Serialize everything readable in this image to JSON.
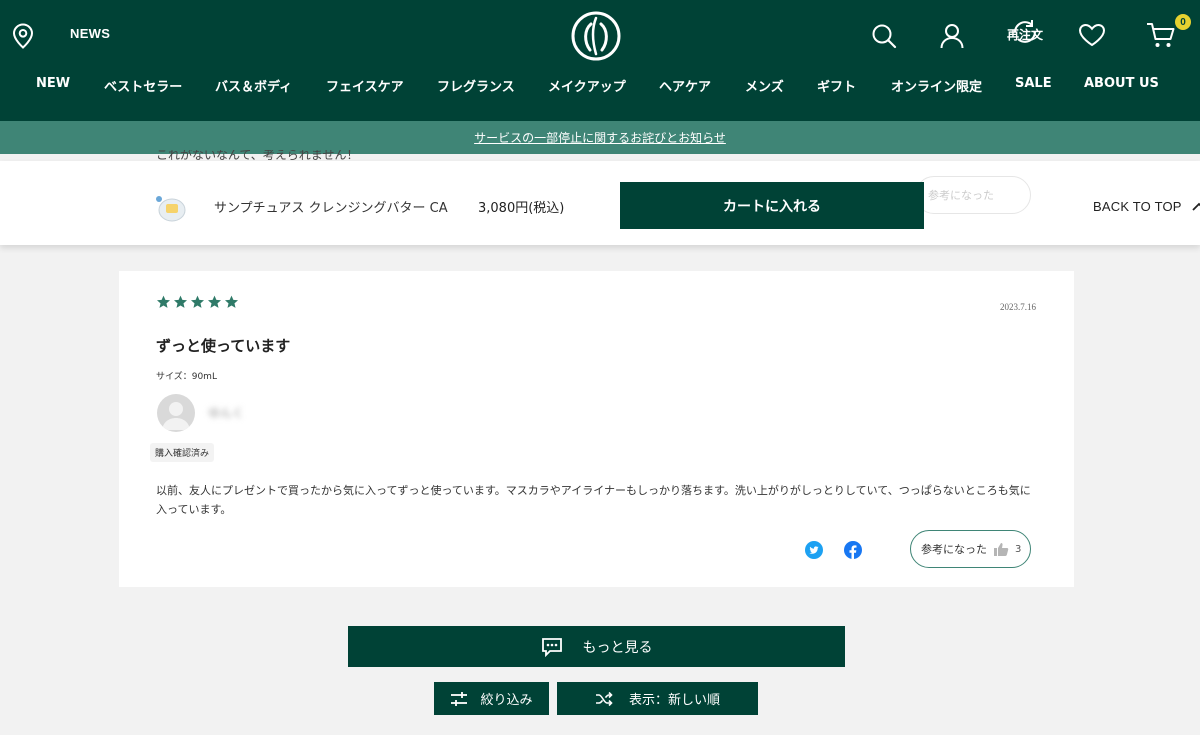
{
  "header": {
    "news_label": "NEWS",
    "reorder_label": "再注文",
    "cart_count": "0",
    "icons": [
      "location-icon",
      "logo",
      "search-icon",
      "account-icon",
      "reorder-icon",
      "heart-icon",
      "cart-icon"
    ]
  },
  "nav": {
    "items": [
      {
        "label": "NEW"
      },
      {
        "label": "ベストセラー"
      },
      {
        "label": "バス＆ボディ"
      },
      {
        "label": "フェイスケア"
      },
      {
        "label": "フレグランス"
      },
      {
        "label": "メイクアップ"
      },
      {
        "label": "ヘアケア"
      },
      {
        "label": "メンズ"
      },
      {
        "label": "ギフト"
      },
      {
        "label": "オンライン限定"
      },
      {
        "label": "SALE"
      },
      {
        "label": "ABOUT US"
      }
    ]
  },
  "notice": {
    "text": "サービスの一部停止に関するお詫びとお知らせ"
  },
  "partial_review_text": "これがないなんて、考えられません！",
  "sticky": {
    "product_name": "サンプチュアス クレンジングバター CA",
    "price": "3,080円(税込)",
    "add_to_cart": "カートに入れる",
    "back_to_top": "BACK TO TOP",
    "faded_helpful": "参考になった"
  },
  "review": {
    "rating": 5,
    "date": "2023.7.16",
    "title": "ずっと使っています",
    "size": "サイズ：90mL",
    "reviewer": "ゆんく",
    "verified": "購入確認済み",
    "body": "以前、友人にプレゼントで買ったから気に入ってずっと使っています。マスカラやアイライナーもしっかり落ちます。洗い上がりがしっとりしていて、つっぱらないところも気に入っています。",
    "helpful_label": "参考になった",
    "helpful_count": "3"
  },
  "actions": {
    "more_label": "もっと見る",
    "filter_label": "絞り込み",
    "sort_label": "表示：新しい順"
  },
  "colors": {
    "brand_green": "#004236",
    "notice_green": "#3f8576",
    "star_green": "#2f7a68",
    "badge_yellow": "#e6d230"
  }
}
